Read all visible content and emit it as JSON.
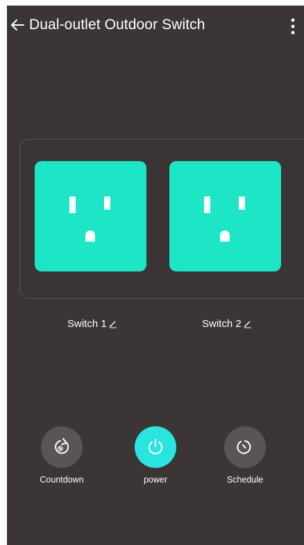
{
  "header": {
    "title": "Dual-outlet Outdoor Switch",
    "back_icon": "arrow-left-icon",
    "menu_icon": "more-vertical-icon"
  },
  "outlets": [
    {
      "label": "Switch 1",
      "state": "on",
      "color": "#1de6c6",
      "edit_icon": "pencil-icon"
    },
    {
      "label": "Switch 2",
      "state": "on",
      "color": "#1de6c6",
      "edit_icon": "pencil-icon"
    }
  ],
  "controls": [
    {
      "label": "Countdown",
      "icon": "countdown-timer-icon"
    },
    {
      "label": "power",
      "icon": "power-icon",
      "color": "#2ae5df"
    },
    {
      "label": "Schedule",
      "icon": "schedule-clock-icon"
    }
  ],
  "colors": {
    "background": "#3b3536",
    "accent": "#1de6c6",
    "text": "#ffffff"
  }
}
